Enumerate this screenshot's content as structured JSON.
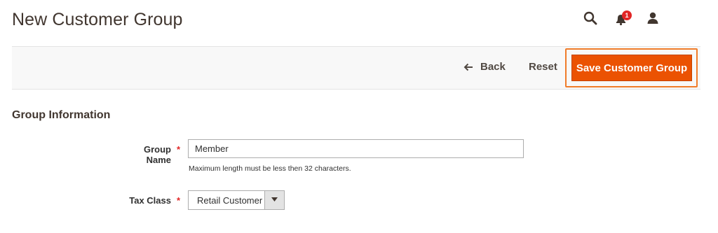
{
  "page": {
    "title": "New Customer Group"
  },
  "header": {
    "icons": [
      "search-icon",
      "bell-icon",
      "user-icon"
    ],
    "notification_count": "1"
  },
  "toolbar": {
    "back_label": "Back",
    "reset_label": "Reset",
    "save_label": "Save Customer Group"
  },
  "section": {
    "title": "Group Information"
  },
  "form": {
    "group_name": {
      "label": "Group Name",
      "value": "Member",
      "note": "Maximum length must be less then 32 characters."
    },
    "tax_class": {
      "label": "Tax Class",
      "selected": "Retail Customer"
    }
  },
  "colors": {
    "accent": "#eb5202",
    "highlight_border": "#f07c2a",
    "required": "#e22626",
    "badge": "#e22626"
  }
}
